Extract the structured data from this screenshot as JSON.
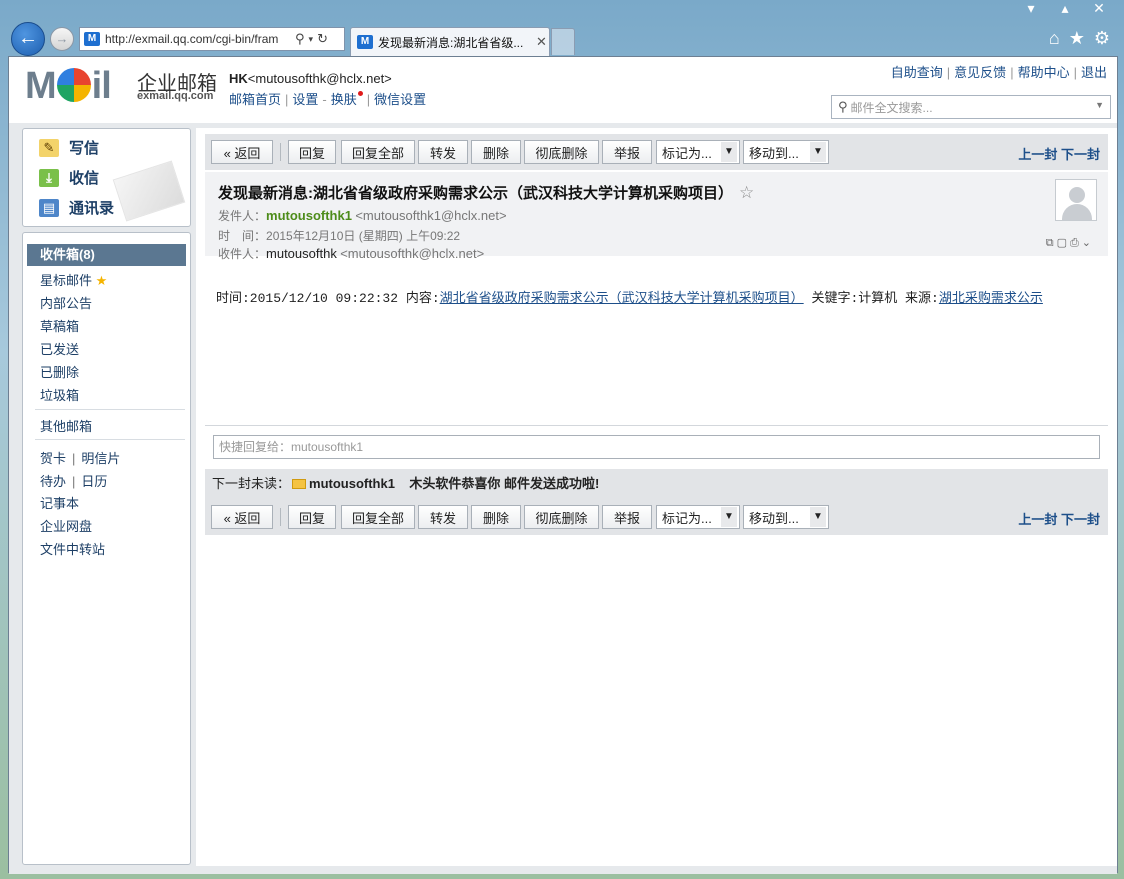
{
  "browser": {
    "url": "http://exmail.qq.com/cgi-bin/fram",
    "tab_title": "发现最新消息:湖北省省级...",
    "site_icon_text": "M"
  },
  "header": {
    "logo_text": "M",
    "logo_text2": "il",
    "logo_cn": "企业邮箱",
    "logo_domain": "exmail.qq.com",
    "user_name": "HK",
    "user_email": "<mutousofthk@hclx.net>",
    "links": [
      "邮箱首页",
      "设置",
      "换肤",
      "微信设置"
    ],
    "top_links": [
      "自助查询",
      "意见反馈",
      "帮助中心",
      "退出"
    ],
    "search_placeholder": "邮件全文搜索..."
  },
  "sidebar": {
    "actions": [
      "写信",
      "收信",
      "通讯录"
    ],
    "folders": {
      "inbox": "收件箱(8)",
      "starred": "星标邮件",
      "notice": "内部公告",
      "drafts": "草稿箱",
      "sent": "已发送",
      "deleted": "已删除",
      "spam": "垃圾箱",
      "other": "其他邮箱",
      "card": "贺卡",
      "postcard": "明信片",
      "todo": "待办",
      "calendar": "日历",
      "notes": "记事本",
      "disk": "企业网盘",
      "transfer": "文件中转站"
    }
  },
  "toolbar": {
    "back": "« 返回",
    "reply": "回复",
    "reply_all": "回复全部",
    "forward": "转发",
    "delete": "删除",
    "delete_perm": "彻底删除",
    "report": "举报",
    "mark_as": "标记为...",
    "move_to": "移动到...",
    "prev": "上一封",
    "next": "下一封"
  },
  "mail": {
    "subject": "发现最新消息:湖北省省级政府采购需求公示（武汉科技大学计算机采购项目）",
    "from_label": "发件人：",
    "from_name": "mutousofthk1",
    "from_addr": "<mutousofthk1@hclx.net>",
    "time_label": "时　间：",
    "time_value": "2015年12月10日 (星期四) 上午09:22",
    "to_label": "收件人：",
    "to_name": "mutousofthk",
    "to_addr": "<mutousofthk@hclx.net>",
    "body_time": "时间:2015/12/10 09:22:32 内容:",
    "body_link": "湖北省省级政府采购需求公示（武汉科技大学计算机采购项目）",
    "body_keyword": " 关键字:计算机 来源:",
    "body_source": "湖北采购需求公示"
  },
  "quick_reply_placeholder": "快捷回复给：mutousofthk1",
  "next_unread": {
    "label": "下一封未读：",
    "sender": "mutousofthk1",
    "subject": "木头软件恭喜你 邮件发送成功啦!"
  }
}
